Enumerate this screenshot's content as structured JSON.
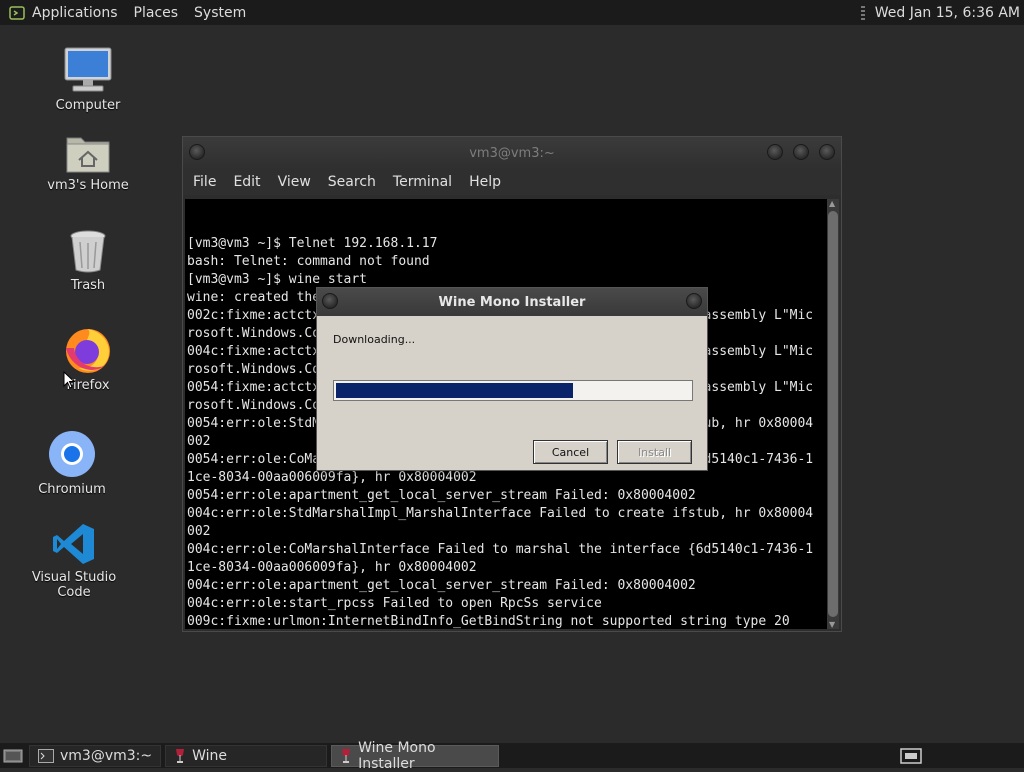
{
  "top_panel": {
    "menus": [
      "Applications",
      "Places",
      "System"
    ],
    "clock": "Wed Jan 15,  6:36 AM"
  },
  "desktop": {
    "icons": [
      {
        "label": "Computer",
        "icon": "computer-icon"
      },
      {
        "label": "vm3's Home",
        "icon": "home-folder-icon"
      },
      {
        "label": "Trash",
        "icon": "trash-icon"
      },
      {
        "label": "Firefox",
        "icon": "firefox-icon"
      },
      {
        "label": "Chromium",
        "icon": "chromium-icon"
      },
      {
        "label": "Visual Studio Code",
        "icon": "vscode-icon"
      }
    ]
  },
  "terminal": {
    "title": "vm3@vm3:~",
    "menu": [
      "File",
      "Edit",
      "View",
      "Search",
      "Terminal",
      "Help"
    ],
    "lines": [
      "[vm3@vm3 ~]$ Telnet 192.168.1.17",
      "bash: Telnet: command not found",
      "[vm3@vm3 ~]$ wine start",
      "wine: created the configuration directory '/home/vm3/.wine'",
      "002c:fixme:actctx:parse_depend_manifests Could not find dependent assembly L\"Mic",
      "rosoft.Windows.Common-Controls\" (6.0.0.0)",
      "004c:fixme:actctx:parse_depend_manifests Could not find dependent assembly L\"Mic",
      "rosoft.Windows.Common-Controls\" (6.0.0.0)",
      "0054:fixme:actctx:parse_depend_manifests Could not find dependent assembly L\"Mic",
      "rosoft.Windows.Common-Controls\" (6.0.0.0)",
      "0054:err:ole:StdMarshalImpl_MarshalInterface Failed to create ifstub, hr 0x80004",
      "002",
      "0054:err:ole:CoMarshalInterface Failed to marshal the interface {6d5140c1-7436-1",
      "1ce-8034-00aa006009fa}, hr 0x80004002",
      "0054:err:ole:apartment_get_local_server_stream Failed: 0x80004002",
      "004c:err:ole:StdMarshalImpl_MarshalInterface Failed to create ifstub, hr 0x80004",
      "002",
      "004c:err:ole:CoMarshalInterface Failed to marshal the interface {6d5140c1-7436-1",
      "1ce-8034-00aa006009fa}, hr 0x80004002",
      "004c:err:ole:apartment_get_local_server_stream Failed: 0x80004002",
      "004c:err:ole:start_rpcss Failed to open RpcSs service",
      "009c:fixme:urlmon:InternetBindInfo_GetBindString not supported string type 20"
    ]
  },
  "dialog": {
    "title": "Wine Mono Installer",
    "status": "Downloading...",
    "progress": 0.67,
    "cancel_label": "Cancel",
    "install_label": "Install"
  },
  "taskbar": {
    "items": [
      {
        "label": "vm3@vm3:~",
        "icon": "terminal-icon",
        "active": false
      },
      {
        "label": "Wine",
        "icon": "wine-icon",
        "active": false
      },
      {
        "label": "Wine Mono Installer",
        "icon": "wine-icon",
        "active": true
      }
    ]
  }
}
